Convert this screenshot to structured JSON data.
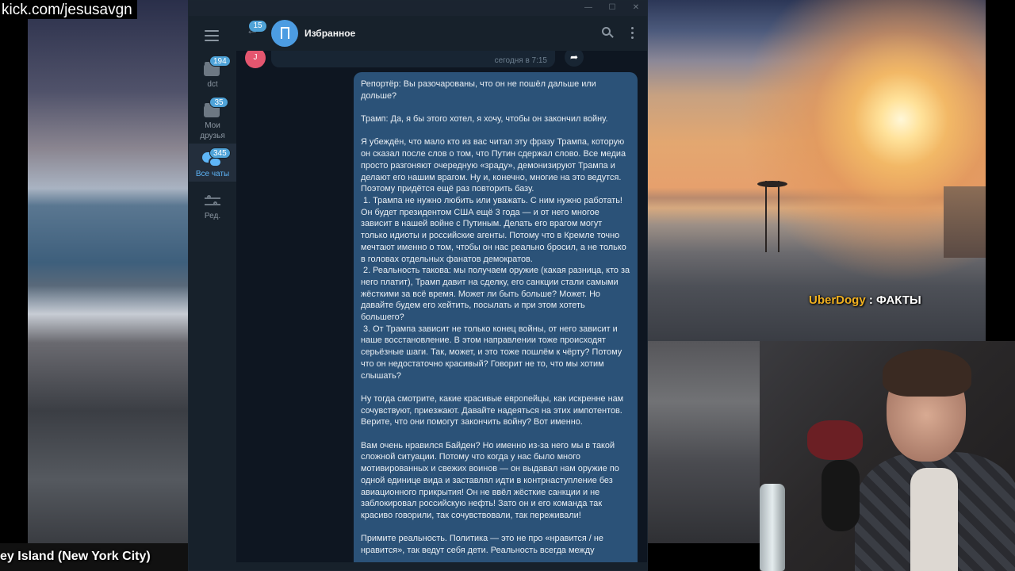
{
  "stream": {
    "channel_url": "kick.com/jesusavgn",
    "location_caption": "ey Island (New York City)",
    "chat_overlay": {
      "user": "UberDogy",
      "separator": " : ",
      "message": "ФАКТЫ"
    }
  },
  "telegram": {
    "window_controls": {
      "minimize": "—",
      "maximize": "☐",
      "close": "✕"
    },
    "folders": [
      {
        "label": "dct",
        "badge": "194",
        "icon": "folder-icon"
      },
      {
        "label": "Мои\nдрузья",
        "badge": "35",
        "icon": "folder-icon"
      },
      {
        "label": "Все чаты",
        "badge": "345",
        "icon": "chats-icon",
        "active": true
      },
      {
        "label": "Ред.",
        "icon": "edit-folders-icon"
      }
    ],
    "header": {
      "back_badge": "15",
      "title": "Избранное"
    },
    "previous_message": {
      "avatar_letter": "J",
      "time": "сегодня в 7:15"
    },
    "message": {
      "paragraphs": [
        "Репортёр: Вы разочарованы, что он не пошёл дальше или дольше?",
        "Трамп: Да, я бы этого хотел, я хочу, чтобы он закончил войну.",
        "Я убеждён, что мало кто из вас читал эту фразу Трампа, которую он сказал после слов о том, что Путин сдержал слово. Все медиа просто разгоняют очередную «зраду», демонизируют Трампа и делают его нашим врагом. Ну и, конечно, многие на это ведутся. Поэтому придётся ещё раз повторить базу.\n 1. Трампа не нужно любить или уважать. С ним нужно работать! Он будет президентом США ещё 3 года — и от него многое зависит в нашей войне с Путиным. Делать его врагом могут только идиоты и российские агенты. Потому что в Кремле точно мечтают именно о том, чтобы он нас реально бросил, а не только в головах отдельных фанатов демократов.\n 2. Реальность такова: мы получаем оружие (какая разница, кто за него платит), Трамп давит на сделку, его санкции стали самыми жёсткими за всё время. Может ли быть больше? Может. Но давайте будем его хейтить, посылать и при этом хотеть большего?\n 3. От Трампа зависит не только конец войны, от него зависит и наше восстановление. В этом направлении тоже происходят серьёзные шаги. Так, может, и это тоже пошлём к чёрту? Потому что он недостаточно красивый? Говорит не то, что мы хотим слышать?",
        "Ну тогда смотрите, какие красивые европейцы, как искренне нам сочувствуют, приезжают. Давайте надеяться на этих импотентов. Верите, что они помогут закончить войну? Вот именно.",
        "Вам очень нравился Байден? Но именно из-за него мы в такой сложной ситуации. Потому что когда у нас было много мотивированных и свежих воинов — он выдавал нам оружие по одной единице вида и заставлял идти в контрнаступление без авиационного прикрытия! Он не ввёл жёсткие санкции и не заблокировал российскую нефть! Зато он и его команда так красиво говорили, так сочувствовали, так переживали!",
        "Примите реальность. Политика — это не про «нравится / не нравится», так ведут себя дети. Реальность всегда между"
      ]
    }
  }
}
